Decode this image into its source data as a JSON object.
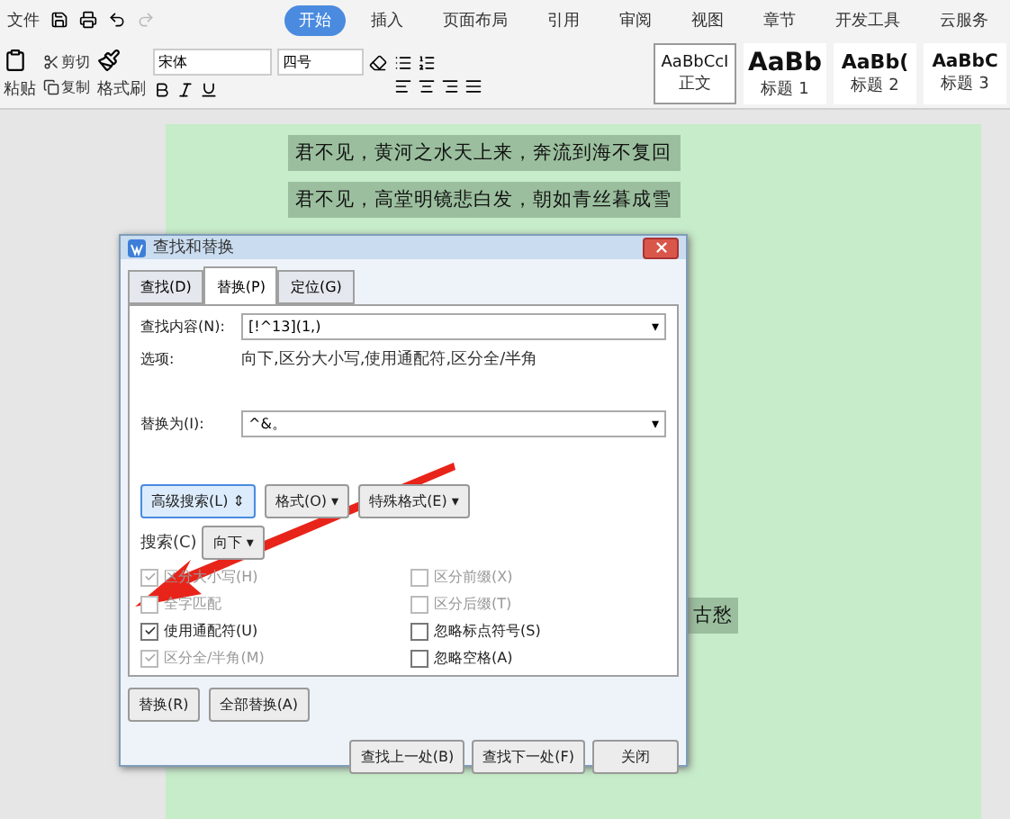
{
  "menu": {
    "file": "文件",
    "tabs": [
      {
        "label": "开始",
        "selected": true
      },
      {
        "label": "插入",
        "selected": false
      },
      {
        "label": "页面布局",
        "selected": false
      },
      {
        "label": "引用",
        "selected": false
      },
      {
        "label": "审阅",
        "selected": false
      },
      {
        "label": "视图",
        "selected": false
      },
      {
        "label": "章节",
        "selected": false
      },
      {
        "label": "开发工具",
        "selected": false
      },
      {
        "label": "云服务",
        "selected": false
      }
    ]
  },
  "ribbon": {
    "paste": "粘贴",
    "cut": "剪切",
    "copy": "复制",
    "format_painter": "格式刷",
    "font": "宋体",
    "size": "四号",
    "styles": [
      {
        "preview": "AaBbCcI",
        "label": "正文",
        "selected": true,
        "kind": "normal"
      },
      {
        "preview": "AaBb",
        "label": "标题 1",
        "selected": false,
        "kind": "h1"
      },
      {
        "preview": "AaBb(",
        "label": "标题 2",
        "selected": false,
        "kind": "h2"
      },
      {
        "preview": "AaBbC",
        "label": "标题 3",
        "selected": false,
        "kind": "h3"
      }
    ]
  },
  "document": {
    "lines": [
      "君不见，黄河之水天上来，奔流到海不复回",
      "君不见，高堂明镜悲白发，朝如青丝暮成雪"
    ],
    "tail": "古愁"
  },
  "dialog": {
    "title": "查找和替换",
    "tabs": [
      {
        "label": "查找(D)",
        "selected": false
      },
      {
        "label": "替换(P)",
        "selected": true
      },
      {
        "label": "定位(G)",
        "selected": false
      }
    ],
    "find_label": "查找内容(N):",
    "find_value": "[!^13](1,)",
    "options_label": "选项:",
    "options_value": "向下,区分大小写,使用通配符,区分全/半角",
    "replace_label": "替换为(I):",
    "replace_value": "^&。",
    "buttons_mid": [
      {
        "label": "高级搜索(L)",
        "arrow": "⇕"
      },
      {
        "label": "格式(O)",
        "arrow": "▾"
      },
      {
        "label": "特殊格式(E)",
        "arrow": "▾"
      }
    ],
    "search_label": "搜索(C)",
    "search_value": "向下",
    "checks_left": [
      {
        "label": "区分大小写(H)",
        "checked": true,
        "disabled": true
      },
      {
        "label": "全字匹配",
        "checked": false,
        "disabled": true
      },
      {
        "label": "使用通配符(U)",
        "checked": true,
        "disabled": false
      },
      {
        "label": "区分全/半角(M)",
        "checked": true,
        "disabled": true
      }
    ],
    "checks_right": [
      {
        "label": "区分前缀(X)",
        "checked": false,
        "disabled": true
      },
      {
        "label": "区分后缀(T)",
        "checked": false,
        "disabled": true
      },
      {
        "label": "忽略标点符号(S)",
        "checked": false,
        "disabled": false
      },
      {
        "label": "忽略空格(A)",
        "checked": false,
        "disabled": false
      }
    ],
    "replace_buttons": [
      "替换(R)",
      "全部替换(A)"
    ],
    "nav_buttons": [
      "查找上一处(B)",
      "查找下一处(F)",
      "关闭"
    ]
  }
}
